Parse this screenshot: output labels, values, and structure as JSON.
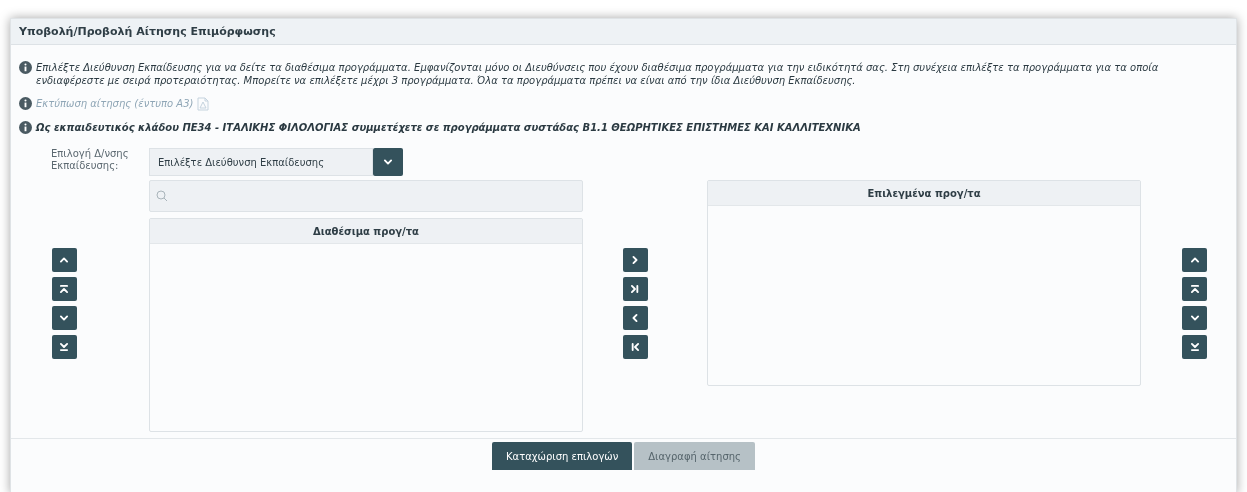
{
  "panel": {
    "title": "Υποβολή/Προβολή Αίτησης Επιμόρφωσης"
  },
  "info_lines": [
    {
      "text": "Επιλέξτε Διεύθυνση Εκπαίδευσης για να δείτε τα διαθέσιμα προγράμματα. Εμφανίζονται μόνο οι Διευθύνσεις που έχουν διαθέσιμα προγράμματα για την ειδικότητά σας. Στη συνέχεια επιλέξτε τα προγράμματα για τα οποία ενδιαφέρεστε με σειρά προτεραιότητας. Μπορείτε να επιλέξετε μέχρι 3 προγράμματα. Όλα τα προγράμματα πρέπει να είναι από την ίδια Διεύθυνση Εκπαίδευσης.",
      "kind": "plain",
      "disabled": false
    },
    {
      "text": "Εκτύπωση αίτησης (έντυπο Α3)",
      "kind": "link",
      "disabled": true
    },
    {
      "text": "Ως εκπαιδευτικός κλάδου ΠΕ34 - ΙΤΑΛΙΚΗΣ ΦΙΛΟΛΟΓΙΑΣ συμμετέχετε σε προγράμματα συστάδας Β1.1 ΘΕΩΡΗΤΙΚΕΣ ΕΠΙΣΤΗΜΕΣ ΚΑΙ ΚΑΛΛΙΤΕΧΝΙΚΑ",
      "kind": "bold",
      "disabled": false
    }
  ],
  "direction_select": {
    "label": "Επιλογή Δ/νσης Εκπαίδευσης:",
    "value": "Επιλέξτε Διεύθυνση Εκπαίδευσης"
  },
  "available_list": {
    "title": "Διαθέσιμα προγ/τα"
  },
  "selected_list": {
    "title": "Επιλεγμένα προγ/τα"
  },
  "left_buttons": [
    {
      "kind": "up"
    },
    {
      "kind": "top"
    },
    {
      "kind": "down"
    },
    {
      "kind": "bottom"
    }
  ],
  "middle_buttons": [
    {
      "kind": "right"
    },
    {
      "kind": "all-right"
    },
    {
      "kind": "left"
    },
    {
      "kind": "all-left"
    }
  ],
  "right_buttons": [
    {
      "kind": "up"
    },
    {
      "kind": "top"
    },
    {
      "kind": "down"
    },
    {
      "kind": "bottom"
    }
  ],
  "footer_buttons": [
    {
      "label": "Καταχώριση επιλογών",
      "disabled": false
    },
    {
      "label": "Διαγραφή αίτησης",
      "disabled": true
    }
  ]
}
